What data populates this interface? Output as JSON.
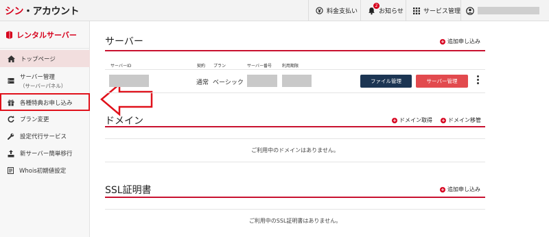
{
  "header": {
    "logo_part1": "シン",
    "logo_part2": "・アカウント",
    "billing": "料金支払い",
    "notifications": "お知らせ",
    "notification_count": "2",
    "services": "サービス管理"
  },
  "sidebar": {
    "title": "レンタルサーバー",
    "items": [
      {
        "label": "トップページ"
      },
      {
        "label": "サーバー管理",
        "sub": "（サーバーパネル）"
      },
      {
        "label": "各種特典お申し込み"
      },
      {
        "label": "プラン変更"
      },
      {
        "label": "設定代行サービス"
      },
      {
        "label": "新サーバー簡単移行"
      },
      {
        "label": "Whois初期値設定"
      }
    ]
  },
  "server_section": {
    "title": "サーバー",
    "add_label": "追加申し込み",
    "columns": [
      "サーバーID",
      "契約",
      "プラン",
      "サーバー番号",
      "利用期限"
    ],
    "row": {
      "contract": "通常",
      "plan": "ベーシック",
      "file_button": "ファイル管理",
      "server_button": "サーバー管理"
    }
  },
  "domain_section": {
    "title": "ドメイン",
    "get_label": "ドメイン取得",
    "transfer_label": "ドメイン移管",
    "empty": "ご利用中のドメインはありません。"
  },
  "ssl_section": {
    "title": "SSL証明書",
    "add_label": "追加申し込み",
    "empty": "ご利用中のSSL証明書はありません。"
  },
  "colors": {
    "brand_red": "#d6001c",
    "navy_button": "#1c3553",
    "red_button": "#e24a4e",
    "highlight": "#e0101a"
  }
}
